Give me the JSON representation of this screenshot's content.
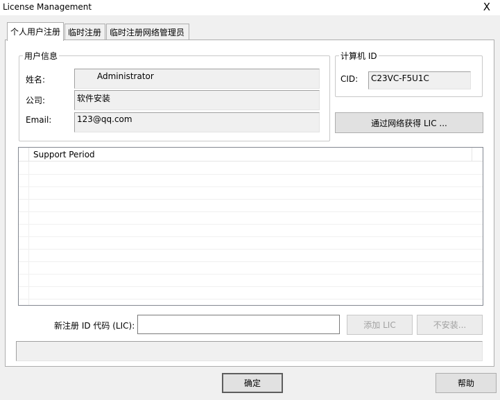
{
  "window": {
    "title": "License Management",
    "close_label": "X"
  },
  "tabs": [
    {
      "label": "个人用户注册",
      "active": true
    },
    {
      "label": "临时注册",
      "active": false
    },
    {
      "label": "临时注册网络管理员",
      "active": false
    }
  ],
  "user_info": {
    "group_title": "用户信息",
    "name_label": "姓名:",
    "name_value": "Administrator",
    "company_label": "公司:",
    "company_value": "软件安装",
    "email_label": "Email:",
    "email_value": "123@qq.com"
  },
  "computer_id": {
    "group_title": "计算机 ID",
    "cid_label": "CID:",
    "cid_value": "C23VC-F5U1C"
  },
  "get_lic_button": "通过网络获得 LIC ...",
  "list": {
    "column_header": "Support Period",
    "rows": []
  },
  "new_lic": {
    "label": "新注册 ID 代码 (LIC):",
    "value": "",
    "add_button": "添加 LIC",
    "uninstall_button": "不安装..."
  },
  "status_text": "",
  "footer": {
    "ok_button": "确定",
    "help_button": "帮助"
  }
}
